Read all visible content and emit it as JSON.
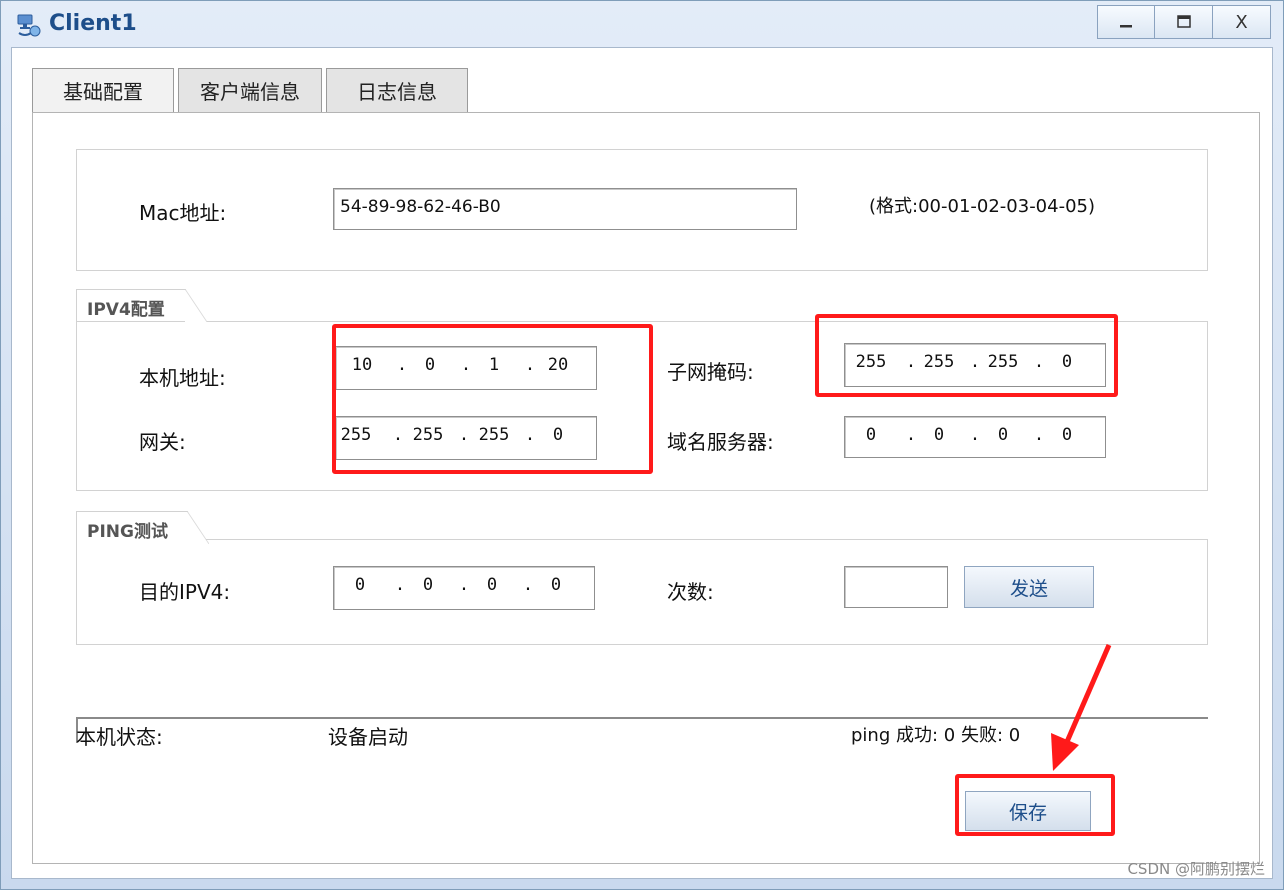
{
  "window": {
    "title": "Client1",
    "icon": "network-client-icon",
    "controls": {
      "minimize": "–",
      "maximize": "□",
      "close": "X"
    }
  },
  "tabs": [
    {
      "label": "基础配置",
      "active": true
    },
    {
      "label": "客户端信息",
      "active": false
    },
    {
      "label": "日志信息",
      "active": false
    }
  ],
  "mac": {
    "label": "Mac地址:",
    "value": "54-89-98-62-46-B0",
    "hint": "(格式:00-01-02-03-04-05)"
  },
  "ipv4": {
    "section_title": "IPV4配置",
    "local_address": {
      "label": "本机地址:",
      "octets": [
        "10",
        "0",
        "1",
        "20"
      ]
    },
    "subnet_mask": {
      "label": "子网掩码:",
      "octets": [
        "255",
        "255",
        "255",
        "0"
      ]
    },
    "gateway": {
      "label": "网关:",
      "octets": [
        "255",
        "255",
        "255",
        "0"
      ]
    },
    "dns": {
      "label": "域名服务器:",
      "octets": [
        "0",
        "0",
        "0",
        "0"
      ]
    }
  },
  "ping": {
    "section_title": "PING测试",
    "target": {
      "label": "目的IPV4:",
      "octets": [
        "0",
        "0",
        "0",
        "0"
      ]
    },
    "count_label": "次数:",
    "count_value": "",
    "send_button": "发送"
  },
  "status": {
    "label": "本机状态:",
    "value": "设备启动",
    "ping_result": "ping 成功: 0 失败: 0"
  },
  "save_button": "保存",
  "watermark": "CSDN @阿鹏别摆烂",
  "colors": {
    "highlight": "#ff1a1a",
    "accent": "#1d4e8a"
  }
}
